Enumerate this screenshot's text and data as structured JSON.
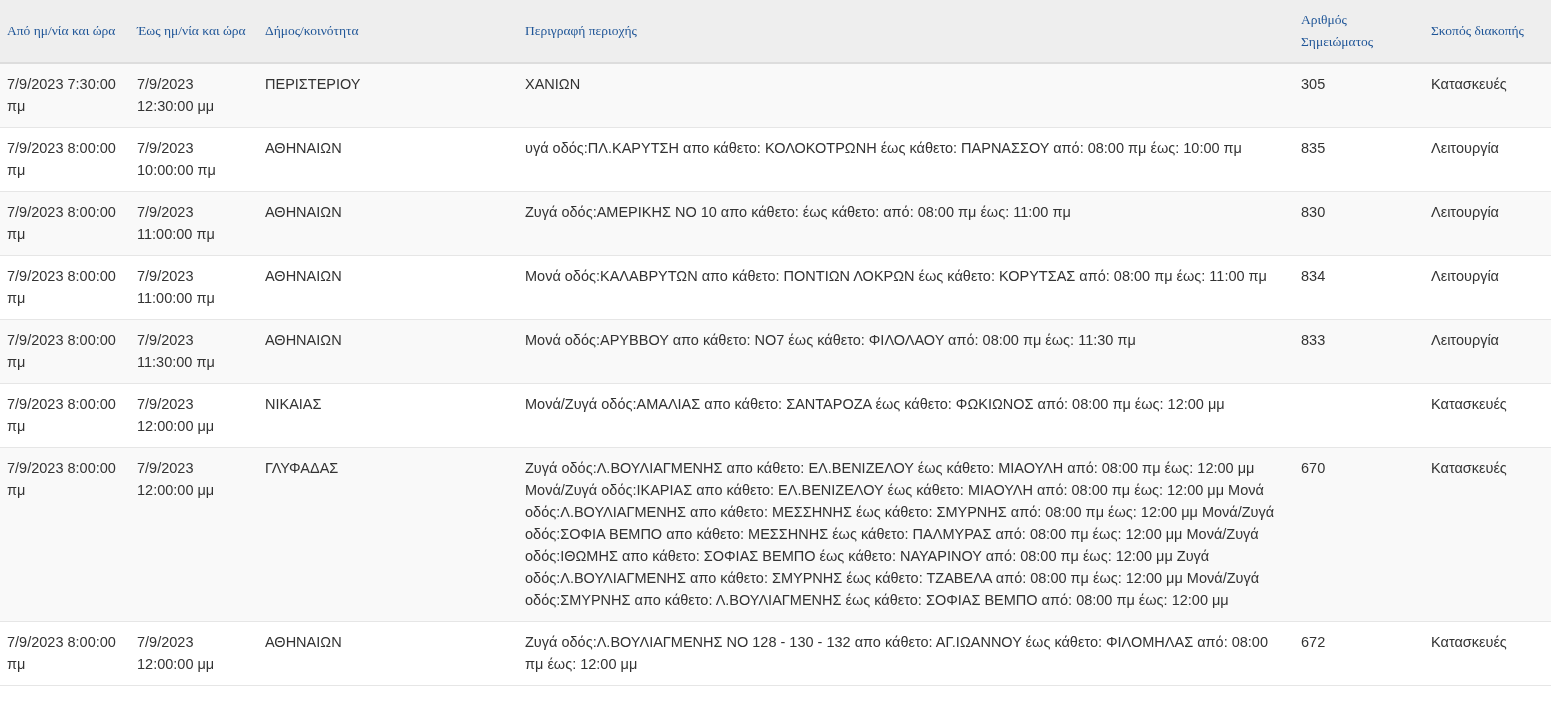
{
  "table": {
    "columns": [
      "Από ημ/νία και ώρα",
      "Έως ημ/νία και ώρα",
      "Δήμος/κοινότητα",
      "Περιγραφή περιοχής",
      "Αριθμός Σημειώματος",
      "Σκοπός διακοπής"
    ],
    "rows": [
      {
        "from": "7/9/2023 7:30:00 πμ",
        "to": "7/9/2023 12:30:00 μμ",
        "municipality": "ΠΕΡΙΣΤΕΡΙΟΥ",
        "description": "ΧΑΝΙΩΝ",
        "note_number": "305",
        "purpose": "Κατασκευές"
      },
      {
        "from": "7/9/2023 8:00:00 πμ",
        "to": "7/9/2023 10:00:00 πμ",
        "municipality": "ΑΘΗΝΑΙΩΝ",
        "description": "υγά οδός:ΠΛ.ΚΑΡΥΤΣΗ απο κάθετο: ΚΟΛΟΚΟΤΡΩΝΗ έως κάθετο: ΠΑΡΝΑΣΣΟΥ από: 08:00 πμ έως: 10:00 πμ",
        "note_number": "835",
        "purpose": "Λειτουργία"
      },
      {
        "from": "7/9/2023 8:00:00 πμ",
        "to": "7/9/2023 11:00:00 πμ",
        "municipality": "ΑΘΗΝΑΙΩΝ",
        "description": "Ζυγά οδός:ΑΜΕΡΙΚΗΣ ΝΟ 10 απο κάθετο: έως κάθετο: από: 08:00 πμ έως: 11:00 πμ",
        "note_number": "830",
        "purpose": "Λειτουργία"
      },
      {
        "from": "7/9/2023 8:00:00 πμ",
        "to": "7/9/2023 11:00:00 πμ",
        "municipality": "ΑΘΗΝΑΙΩΝ",
        "description": "Μονά οδός:ΚΑΛΑΒΡΥΤΩΝ απο κάθετο: ΠΟΝΤΙΩΝ ΛΟΚΡΩΝ έως κάθετο: ΚΟΡΥΤΣΑΣ από: 08:00 πμ έως: 11:00 πμ",
        "note_number": "834",
        "purpose": "Λειτουργία"
      },
      {
        "from": "7/9/2023 8:00:00 πμ",
        "to": "7/9/2023 11:30:00 πμ",
        "municipality": "ΑΘΗΝΑΙΩΝ",
        "description": "Μονά οδός:ΑΡΥΒΒΟΥ απο κάθετο: ΝΟ7 έως κάθετο: ΦΙΛΟΛΑΟΥ από: 08:00 πμ έως: 11:30 πμ",
        "note_number": "833",
        "purpose": "Λειτουργία"
      },
      {
        "from": "7/9/2023 8:00:00 πμ",
        "to": "7/9/2023 12:00:00 μμ",
        "municipality": "ΝΙΚΑΙΑΣ",
        "description": "Μονά/Ζυγά οδός:ΑΜΑΛΙΑΣ απο κάθετο: ΣΑΝΤΑΡΟΖΑ έως κάθετο: ΦΩΚΙΩΝΟΣ από: 08:00 πμ έως: 12:00 μμ",
        "purpose": "Κατασκευές"
      },
      {
        "from": "7/9/2023 8:00:00 πμ",
        "to": "7/9/2023 12:00:00 μμ",
        "municipality": "ΓΛΥΦΑΔΑΣ",
        "description": "Ζυγά οδός:Λ.ΒΟΥΛΙΑΓΜΕΝΗΣ απο κάθετο: ΕΛ.ΒΕΝΙΖΕΛΟΥ έως κάθετο: ΜΙΑΟΥΛΗ από: 08:00 πμ έως: 12:00 μμ Μονά/Ζυγά οδός:ΙΚΑΡΙΑΣ απο κάθετο: ΕΛ.ΒΕΝΙΖΕΛΟΥ έως κάθετο: ΜΙΑΟΥΛΗ από: 08:00 πμ έως: 12:00 μμ Μονά οδός:Λ.ΒΟΥΛΙΑΓΜΕΝΗΣ απο κάθετο: ΜΕΣΣΗΝΗΣ έως κάθετο: ΣΜΥΡΝΗΣ από: 08:00 πμ έως: 12:00 μμ Μονά/Ζυγά οδός:ΣΟΦΙΑ ΒΕΜΠΟ απο κάθετο: ΜΕΣΣΗΝΗΣ έως κάθετο: ΠΑΛΜΥΡΑΣ από: 08:00 πμ έως: 12:00 μμ Μονά/Ζυγά οδός:ΙΘΩΜΗΣ απο κάθετο: ΣΟΦΙΑΣ ΒΕΜΠΟ έως κάθετο: ΝΑΥΑΡΙΝΟΥ από: 08:00 πμ έως: 12:00 μμ Ζυγά οδός:Λ.ΒΟΥΛΙΑΓΜΕΝΗΣ απο κάθετο: ΣΜΥΡΝΗΣ έως κάθετο: ΤΖΑΒΕΛΑ από: 08:00 πμ έως: 12:00 μμ Μονά/Ζυγά οδός:ΣΜΥΡΝΗΣ απο κάθετο: Λ.ΒΟΥΛΙΑΓΜΕΝΗΣ έως κάθετο: ΣΟΦΙΑΣ ΒΕΜΠΟ από: 08:00 πμ έως: 12:00 μμ",
        "note_number": "670",
        "purpose": "Κατασκευές"
      },
      {
        "from": "7/9/2023 8:00:00 πμ",
        "to": "7/9/2023 12:00:00 μμ",
        "municipality": "ΑΘΗΝΑΙΩΝ",
        "description": "Ζυγά οδός:Λ.ΒΟΥΛΙΑΓΜΕΝΗΣ ΝΟ 128 - 130 - 132 απο κάθετο: ΑΓ.ΙΩΑΝΝΟΥ έως κάθετο: ΦΙΛΟΜΗΛΑΣ από: 08:00 πμ έως: 12:00 μμ",
        "note_number": "672",
        "purpose": "Κατασκευές"
      }
    ]
  }
}
